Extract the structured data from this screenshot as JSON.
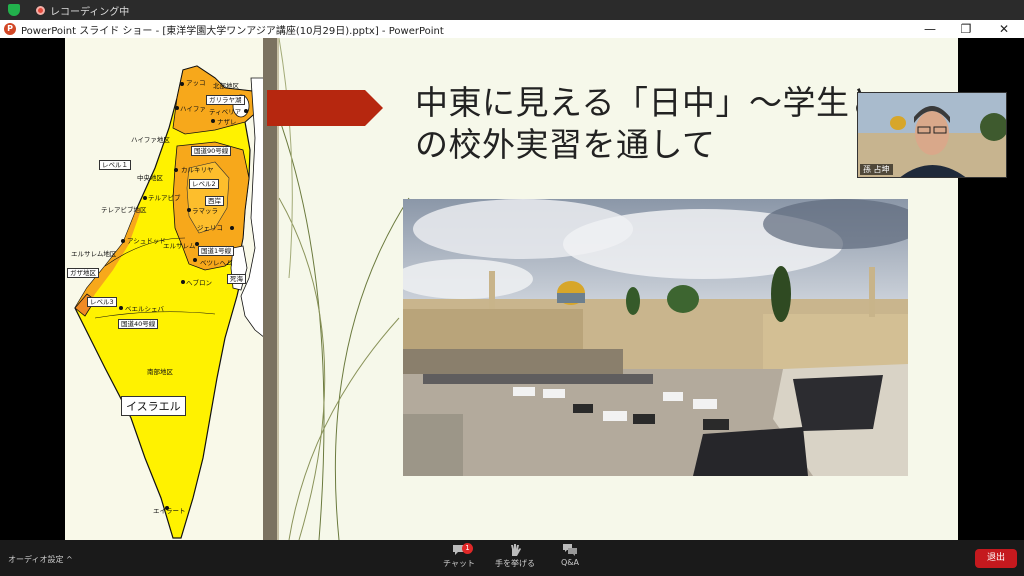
{
  "recording": {
    "label": "レコーディング中"
  },
  "window": {
    "title": "PowerPoint スライド ショー - [東洋学園大学ワンアジア講座(10月29日).pptx] - PowerPoint",
    "app_icon": "P",
    "min_glyph": "—",
    "max_glyph": "❐",
    "close_glyph": "✕"
  },
  "slide": {
    "title": "中東に見える「日中」～学生との校外実習を通して",
    "title_line1": "中東に見える「日中」～学生と",
    "title_line2": "の校外実習を通して"
  },
  "map": {
    "labels": {
      "akko": "アッコ",
      "north": "北部地区",
      "galilee": "ガリラヤ湖",
      "haifa": "ハイファ",
      "tiberias": "ティベリア",
      "nazareth": "ナザレ",
      "haifa_district": "ハイファ地区",
      "route90": "国道90号線",
      "level1": "レベル１",
      "central": "中央地区",
      "qalqilya": "カルキリヤ",
      "level2": "レベル2",
      "telaviv": "テルアビブ",
      "westbank": "西岸",
      "telaviv_district": "テレアビブ地区",
      "ramallah": "ラマッラ",
      "jericho": "ジェリコ",
      "ashdod": "アシュドッド",
      "jerusalem": "エルサレム",
      "jerusalem_district": "エルサレム地区",
      "route1": "国道1号線",
      "bethlehem": "ベツレヘム",
      "gaza": "ガザ地区",
      "deadsea": "死海",
      "hebron": "ヘブロン",
      "level3": "レベル3",
      "beersheba": "ベエルシェバ",
      "route40": "国道40号線",
      "south": "南部地区",
      "israel": "イスラエル",
      "eilat": "エイラート"
    }
  },
  "video": {
    "name": "孫 占坤"
  },
  "controls": {
    "audio_label": "オーディオ設定",
    "audio_chevron": "^",
    "chat_label": "チャット",
    "chat_badge": "1",
    "raise_hand_label": "手を挙げる",
    "qa_label": "Q&A",
    "leave_label": "退出"
  },
  "colors": {
    "map_yellow": "#fff200",
    "map_orange": "#f7a81b",
    "map_dark_orange": "#f08a24",
    "arrow_red": "#b6270f",
    "leave_red": "#c5191e"
  }
}
